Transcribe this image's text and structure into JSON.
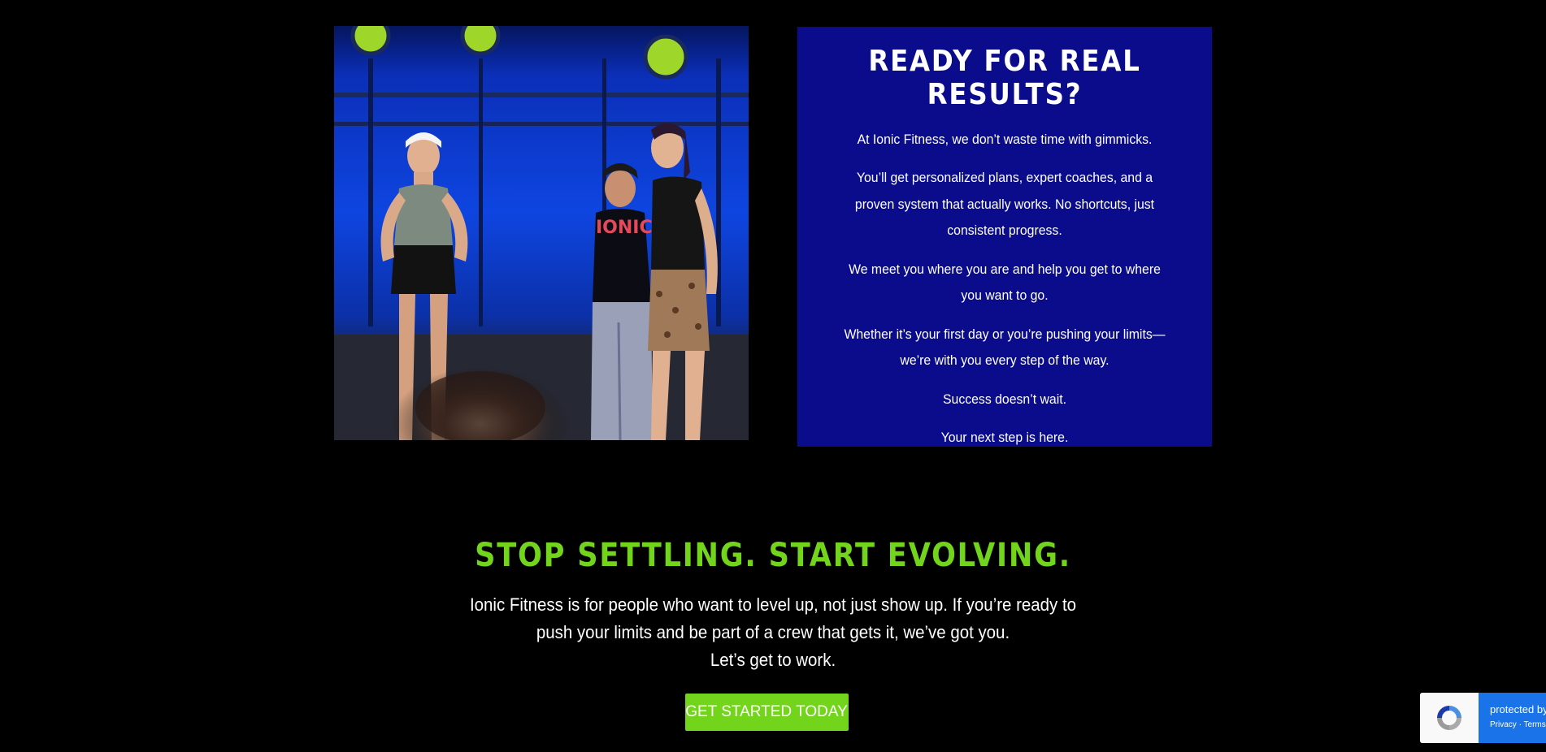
{
  "photo": {
    "icon": "gym-group-photo",
    "shirt_text": "IONIC"
  },
  "card": {
    "title": "READY FOR REAL RESULTS?",
    "paragraphs": [
      "At Ionic Fitness, we don’t waste time with gimmicks.",
      "You’ll get personalized plans, expert coaches, and a proven system that actually works. No shortcuts, just consistent progress.",
      "We meet you where you are and help you get to where you want to go.",
      "Whether it’s your first day or you’re pushing your limits—we’re with you every step of the way.",
      "Success doesn’t wait.",
      "Your next step is here."
    ]
  },
  "cta": {
    "title": "STOP SETTLING. START EVOLVING.",
    "body_line1": "Ionic Fitness is for people who want to level up, not just show up. If you’re ready to push your limits and be part of a crew that gets it, we’ve got you.",
    "body_line2": "Let’s get to work.",
    "button_label": "GET STARTED TODAY"
  },
  "recaptcha": {
    "protected_text": "protected by reCAPTCHA",
    "privacy_label": "Privacy",
    "separator": " · ",
    "terms_label": "Terms"
  },
  "colors": {
    "background": "#000000",
    "card_blue": "#0a0c8c",
    "accent_green": "#73d41c",
    "recaptcha_blue": "#1a73e8"
  }
}
